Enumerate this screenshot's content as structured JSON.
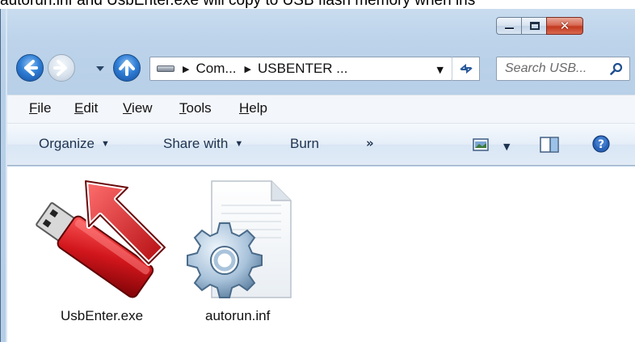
{
  "caption": "autorun.inf and UsbEnter.exe will copy to USB flash memory when ins",
  "window": {
    "caption_buttons": {
      "minimize_icon": "minimize-icon",
      "maximize_icon": "maximize-icon",
      "close_glyph": "✕"
    }
  },
  "nav": {
    "address_crumbs": [
      "Com...",
      "USBENTER ..."
    ],
    "search_placeholder": "Search USB..."
  },
  "menu": [
    "File",
    "Edit",
    "View",
    "Tools",
    "Help"
  ],
  "commands": {
    "organize": "Organize",
    "share_with": "Share with",
    "burn": "Burn",
    "more": "»"
  },
  "files": [
    {
      "name": "UsbEnter.exe",
      "icon": "usb-drive-arrow-icon"
    },
    {
      "name": "autorun.inf",
      "icon": "settings-file-icon"
    }
  ],
  "colors": {
    "frame": "#b8d0e8",
    "close_button": "#c2391f",
    "accent_blue": "#2f7ed6",
    "usb_red": "#c4141a"
  }
}
